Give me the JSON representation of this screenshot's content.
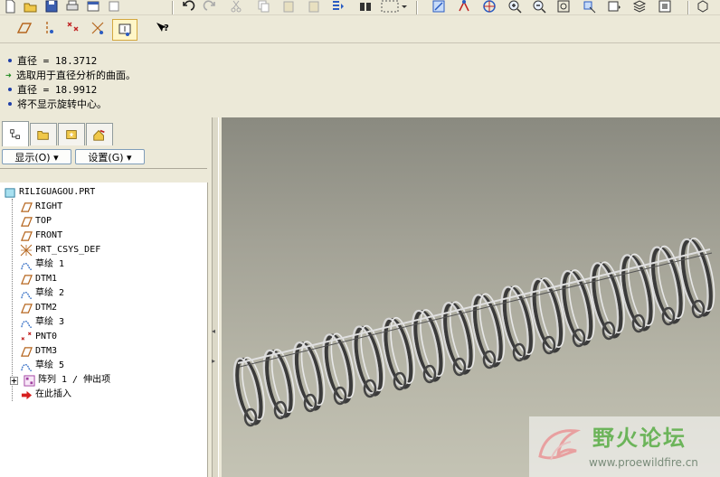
{
  "messages": [
    {
      "type": "bullet",
      "text": "直径 = 18.3712"
    },
    {
      "type": "arrow",
      "text": "选取用于直径分析的曲面。"
    },
    {
      "type": "bullet",
      "text": "直径 = 18.9912"
    },
    {
      "type": "bullet",
      "text": "将不显示旋转中心。"
    }
  ],
  "panel": {
    "show_label": "显示(O)",
    "settings_label": "设置(G)"
  },
  "tree": {
    "root": "RILIGUAGOU.PRT",
    "items": [
      {
        "label": "RIGHT",
        "icon": "datum-plane-icon"
      },
      {
        "label": "TOP",
        "icon": "datum-plane-icon"
      },
      {
        "label": "FRONT",
        "icon": "datum-plane-icon"
      },
      {
        "label": "PRT_CSYS_DEF",
        "icon": "csys-icon"
      },
      {
        "label": "草绘 1",
        "icon": "sketch-icon"
      },
      {
        "label": "DTM1",
        "icon": "datum-plane-icon"
      },
      {
        "label": "草绘 2",
        "icon": "sketch-icon"
      },
      {
        "label": "DTM2",
        "icon": "datum-plane-icon"
      },
      {
        "label": "草绘 3",
        "icon": "sketch-icon"
      },
      {
        "label": "PNT0",
        "icon": "datum-point-icon"
      },
      {
        "label": "DTM3",
        "icon": "datum-plane-icon"
      },
      {
        "label": "草绘 5",
        "icon": "sketch-icon"
      },
      {
        "label": "阵列 1 / 伸出项",
        "icon": "pattern-icon"
      },
      {
        "label": "在此插入",
        "icon": "insert-here-icon"
      }
    ]
  },
  "watermark": {
    "title": "野火论坛",
    "url": "www.proewildfire.cn"
  },
  "colors": {
    "sketch": "#1f5fbf",
    "datum": "#b5651d",
    "insert": "#d62020",
    "watermark": "#6cb45a"
  }
}
